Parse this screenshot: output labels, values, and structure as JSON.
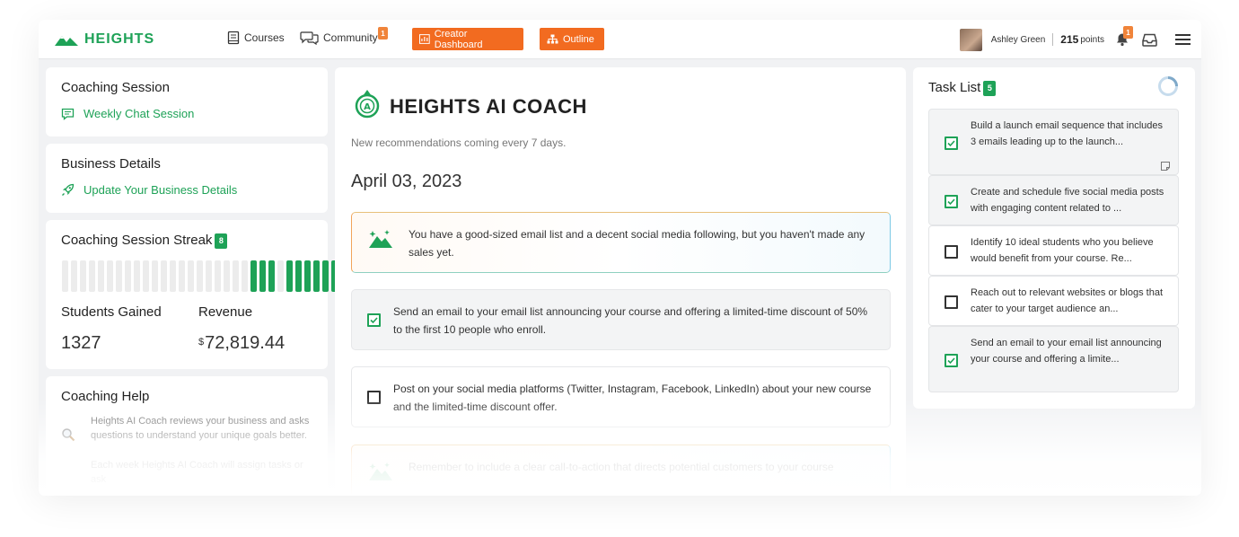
{
  "header": {
    "brand": "HEIGHTS",
    "nav": {
      "courses": "Courses",
      "community": "Community",
      "community_badge": "1"
    },
    "buttons": {
      "creator_dashboard": "Creator Dashboard",
      "outline": "Outline"
    },
    "user": {
      "name": "Ashley Green",
      "points_value": "215",
      "points_label": "points",
      "notification_count": "1"
    }
  },
  "left": {
    "coaching_session": {
      "title": "Coaching Session",
      "link": "Weekly Chat Session"
    },
    "business_details": {
      "title": "Business Details",
      "link": "Update Your Business Details"
    },
    "streak": {
      "title": "Coaching Session Streak",
      "badge": "8",
      "bars": [
        0,
        0,
        0,
        0,
        0,
        0,
        0,
        0,
        0,
        0,
        0,
        0,
        0,
        0,
        0,
        0,
        0,
        0,
        0,
        0,
        0,
        1,
        1,
        1,
        0,
        1,
        1,
        1,
        1,
        1,
        1,
        1,
        1,
        1,
        1
      ],
      "students_label": "Students Gained",
      "students_value": "1327",
      "revenue_label": "Revenue",
      "revenue_currency": "$",
      "revenue_value": "72,819.44"
    },
    "help": {
      "title": "Coaching Help",
      "text1": "Heights AI Coach reviews your business and asks questions to understand your unique goals better.",
      "text2": "Each week Heights AI Coach will assign tasks or ask"
    }
  },
  "center": {
    "title": "HEIGHTS AI COACH",
    "subtitle": "New recommendations coming every 7 days.",
    "date": "April 03, 2023",
    "insight": "You have a good-sized email list and a decent social media following, but you haven't made any sales yet.",
    "tasks": [
      {
        "text": "Send an email to your email list announcing your course and offering a limited-time discount of 50% to the first 10 people who enroll.",
        "done": true
      },
      {
        "text": "Post on your social media platforms (Twitter, Instagram, Facebook, LinkedIn) about your new course and the limited-time discount offer.",
        "done": false
      }
    ],
    "reminder": "Remember to include a clear call-to-action that directs potential customers to your course"
  },
  "task_list": {
    "title": "Task List",
    "count": "5",
    "items": [
      {
        "text": "Build a launch email sequence that includes 3 emails leading up to the launch...",
        "done": true
      },
      {
        "text": "Create and schedule five social media posts with engaging content related to ...",
        "done": true
      },
      {
        "text": "Identify 10 ideal students who you believe would benefit from your course. Re...",
        "done": false
      },
      {
        "text": "Reach out to relevant websites or blogs that cater to your target audience an...",
        "done": false
      },
      {
        "text": "Send an email to your email list announcing your course and offering a limite...",
        "done": true
      }
    ]
  },
  "colors": {
    "brand_green": "#1ea257",
    "accent_orange": "#f26b20"
  }
}
